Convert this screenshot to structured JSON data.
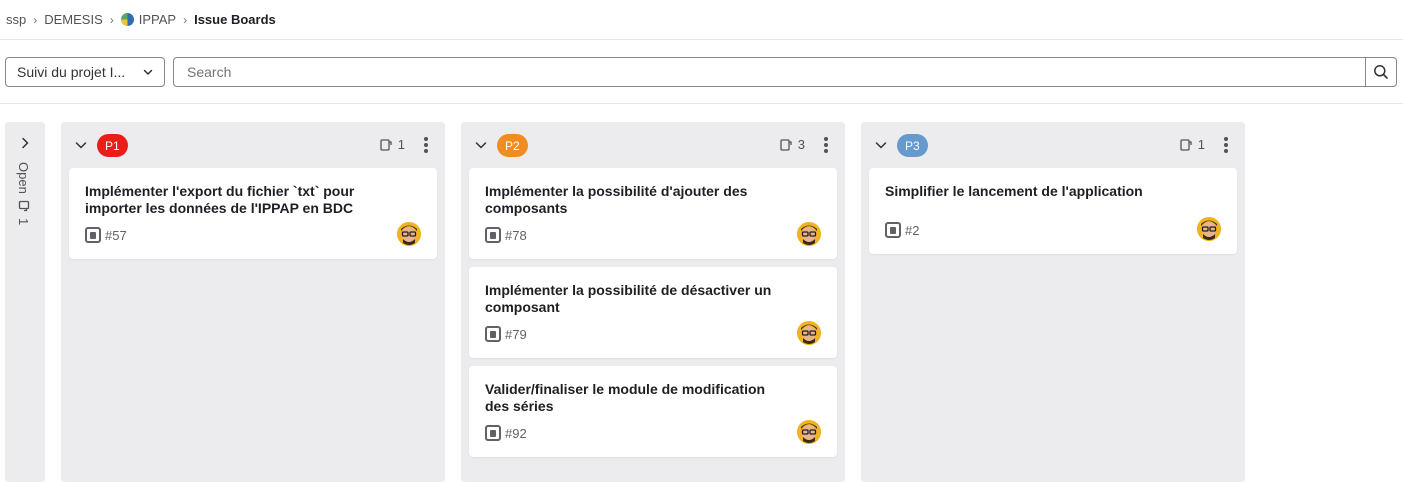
{
  "breadcrumb": {
    "items": [
      "ssp",
      "DEMESIS",
      "IPPAP"
    ],
    "current": "Issue Boards"
  },
  "filters": {
    "board_select": "Suivi du projet I...",
    "search_placeholder": "Search"
  },
  "collapsed_list": {
    "label": "Open",
    "count": "1"
  },
  "lists": [
    {
      "label": "P1",
      "color": "#ec1d19",
      "count": "1",
      "cards": [
        {
          "title": "Implémenter l'export du fichier `txt` pour importer les données de l'IPPAP en BDC",
          "ref": "#57"
        }
      ]
    },
    {
      "label": "P2",
      "color": "#ef8d22",
      "count": "3",
      "cards": [
        {
          "title": "Implémenter la possibilité d'ajouter des composants",
          "ref": "#78"
        },
        {
          "title": "Implémenter la possibilité de désactiver un composant",
          "ref": "#79"
        },
        {
          "title": "Valider/finaliser le module de modification des séries",
          "ref": "#92"
        }
      ]
    },
    {
      "label": "P3",
      "color": "#6699cc",
      "count": "1",
      "cards": [
        {
          "title": "Simplifier le lancement de l'application",
          "ref": "#2"
        }
      ]
    }
  ],
  "icons": {
    "chevron": "chevron-down-icon",
    "issue": "issue-type-icon",
    "count": "issues-count-icon",
    "search": "search-icon",
    "more": "kebab-menu-icon"
  }
}
